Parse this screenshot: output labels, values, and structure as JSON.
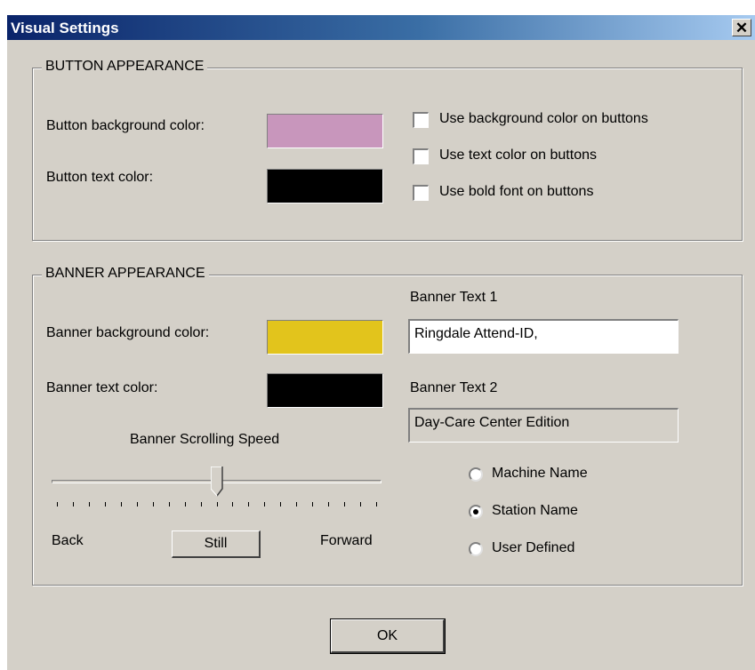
{
  "window": {
    "title": "Visual Settings",
    "close_glyph": "✕"
  },
  "button_appearance": {
    "legend": "BUTTON APPEARANCE",
    "bg_label": "Button background color:",
    "bg_color": "#c896bc",
    "text_label": "Button text color:",
    "text_color": "#000000",
    "checkboxes": [
      {
        "label": "Use background color on buttons",
        "checked": false
      },
      {
        "label": "Use text color on buttons",
        "checked": false
      },
      {
        "label": "Use bold font on buttons",
        "checked": false
      }
    ]
  },
  "banner_appearance": {
    "legend": "BANNER APPEARANCE",
    "bg_label": "Banner background color:",
    "bg_color": "#e2c41c",
    "text_label": "Banner text color:",
    "text_color": "#000000",
    "speed_label": "Banner Scrolling Speed",
    "speed_fraction": 0.5,
    "slider_back": "Back",
    "slider_forward": "Forward",
    "still_button": "Still",
    "banner_text_1_label": "Banner Text 1",
    "banner_text_1_value": "Ringdale Attend-ID,",
    "banner_text_2_label": "Banner Text 2",
    "banner_text_2_value": "Day-Care Center Edition",
    "radios": [
      {
        "label": "Machine Name",
        "selected": false
      },
      {
        "label": "Station Name",
        "selected": true
      },
      {
        "label": "User Defined",
        "selected": false
      }
    ]
  },
  "ok_button": "OK"
}
